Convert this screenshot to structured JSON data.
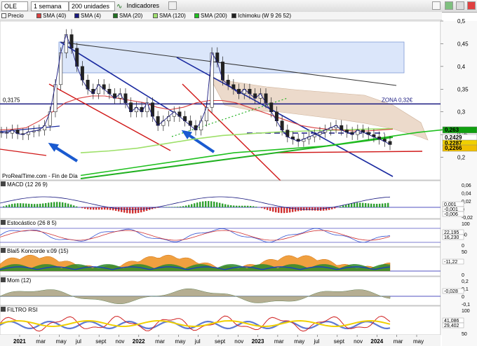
{
  "toolbar": {
    "symbol": "OLE",
    "period": "1 semana",
    "units": "200 unidades",
    "indicators": "Indicadores"
  },
  "legend": [
    {
      "label": "Precio",
      "color": "#ffffff"
    },
    {
      "label": "SMA (40)",
      "color": "#d94040"
    },
    {
      "label": "SMA (4)",
      "color": "#1a1a80"
    },
    {
      "label": "SMA (20)",
      "color": "#207020"
    },
    {
      "label": "SMA (120)",
      "color": "#a0e070"
    },
    {
      "label": "SMA (200)",
      "color": "#20c020"
    },
    {
      "label": "Ichimoku (W 9 26 52)",
      "color": "#202020"
    }
  ],
  "main_labels": {
    "level_label": "0,3175",
    "zone_label": "ZONA 0,32€",
    "source": "ProRealTime.com - Fin de Día"
  },
  "price_badges": [
    {
      "text": "0,263",
      "color": "#10a010"
    },
    {
      "text": "0,2429",
      "color": "#ffffff"
    },
    {
      "text": "0,2287",
      "color": "#f0d000"
    },
    {
      "text": "0,2266",
      "color": "#f0c000"
    }
  ],
  "panels": [
    {
      "title": "MACD (12 26 9)",
      "ticks": [
        "0,06",
        "0,04",
        "0,02",
        "0",
        "-0,02"
      ],
      "badges": [
        "0,001",
        "-0,001",
        "-0,006"
      ]
    },
    {
      "title": "Estocástico (26 8 5)",
      "ticks": [
        "100",
        "50",
        "0"
      ],
      "badges": [
        "22,195",
        "16,230"
      ]
    },
    {
      "title": "Blai5 Koncorde v.09 (15)",
      "ticks": [
        "50",
        "0"
      ],
      "badges": [
        "-11,22"
      ]
    },
    {
      "title": "Mom (12)",
      "ticks": [
        "0,2",
        "0,1",
        "0",
        "-0,1"
      ],
      "badges": [
        "-0,028"
      ]
    },
    {
      "title": "FILTRO RSI",
      "ticks": [
        "100",
        "50"
      ],
      "badges": [
        "41,086",
        "29,402"
      ]
    }
  ],
  "x_axis": [
    "2021",
    "mar",
    "may",
    "jul",
    "sept",
    "nov",
    "2022",
    "mar",
    "may",
    "jul",
    "sept",
    "nov",
    "2023",
    "mar",
    "may",
    "jul",
    "sept",
    "nov",
    "2024",
    "mar",
    "may"
  ],
  "chart_data": {
    "type": "line",
    "title": "",
    "ylabel": "",
    "ylim": [
      0.15,
      0.5
    ],
    "y_ticks": [
      0.5,
      0.45,
      0.4,
      0.35,
      0.3,
      0.25,
      0.2
    ],
    "x_labels": [
      "2021",
      "mar",
      "may",
      "jul",
      "sept",
      "nov",
      "2022",
      "mar",
      "may",
      "jul",
      "sept",
      "nov",
      "2023",
      "mar",
      "may",
      "jul",
      "sept",
      "nov",
      "2024",
      "mar",
      "may"
    ],
    "series": [
      {
        "name": "Precio",
        "values": [
          0.255,
          0.253,
          0.26,
          0.252,
          0.25,
          0.256,
          0.258,
          0.26,
          0.27,
          0.3,
          0.36,
          0.43,
          0.47,
          0.44,
          0.4,
          0.37,
          0.35,
          0.34,
          0.36,
          0.35,
          0.34,
          0.33,
          0.34,
          0.32,
          0.3,
          0.31,
          0.3,
          0.32,
          0.29,
          0.27,
          0.28,
          0.29,
          0.3,
          0.29,
          0.28,
          0.27,
          0.26,
          0.28,
          0.31,
          0.43,
          0.41,
          0.37,
          0.36,
          0.35,
          0.34,
          0.35,
          0.34,
          0.33,
          0.34,
          0.32,
          0.3,
          0.28,
          0.26,
          0.245,
          0.24,
          0.235,
          0.24,
          0.245,
          0.25,
          0.255,
          0.26,
          0.265,
          0.27,
          0.26,
          0.255,
          0.25,
          0.26,
          0.255,
          0.25,
          0.245,
          0.24,
          0.235,
          0.228
        ]
      },
      {
        "name": "SMA (40)",
        "values": [
          0.26,
          0.262,
          0.265,
          0.28,
          0.3,
          0.32,
          0.33,
          0.335,
          0.335,
          0.33,
          0.325,
          0.32,
          0.31,
          0.305,
          0.31,
          0.32,
          0.325,
          0.325,
          0.32,
          0.31,
          0.3,
          0.29,
          0.28,
          0.27,
          0.265,
          0.262,
          0.26,
          0.258,
          0.258,
          0.26,
          0.262
        ]
      },
      {
        "name": "SMA (120)",
        "values": [
          0.21,
          0.214,
          0.22,
          0.23,
          0.24,
          0.248,
          0.252,
          0.256,
          0.258,
          0.26,
          0.262,
          0.263
        ]
      },
      {
        "name": "SMA (200)",
        "values": [
          0.16,
          0.17,
          0.18,
          0.19,
          0.2,
          0.21,
          0.215,
          0.22,
          0.225,
          0.235,
          0.245,
          0.255,
          0.262
        ]
      }
    ]
  }
}
